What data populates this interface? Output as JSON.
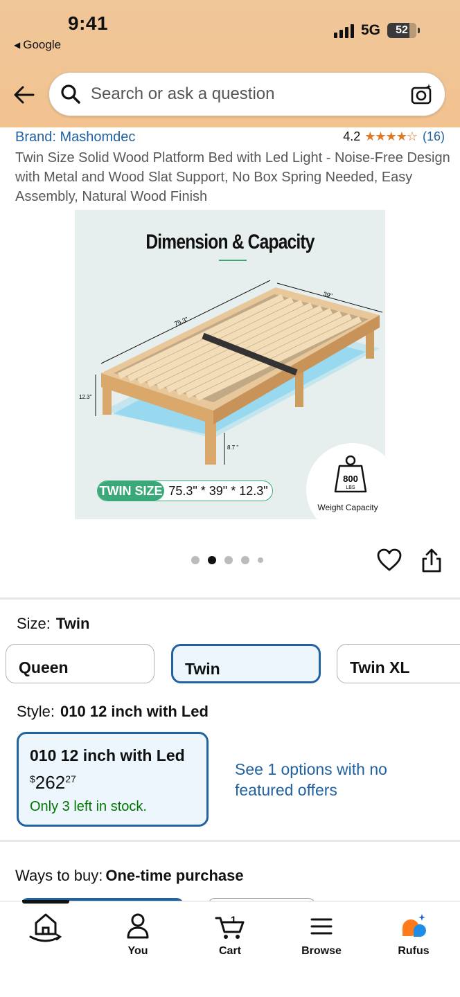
{
  "status": {
    "time": "9:41",
    "back_app": "Google",
    "network": "5G",
    "battery": "52"
  },
  "search": {
    "placeholder": "Search or ask a question"
  },
  "product": {
    "brand": "Brand: Mashomdec",
    "rating": "4.2",
    "stars": "★★★★☆",
    "review_count": "(16)",
    "title": "Twin Size Solid Wood Platform Bed with Led Light - Noise-Free Design with Metal and Wood Slat Support, No Box Spring Needed, Easy Assembly, Natural Wood Finish"
  },
  "image": {
    "heading": "Dimension & Capacity",
    "len": "75.3\"",
    "wid": "39\"",
    "height": "12.3\"",
    "leg": "8.7 \"",
    "badge_label": "TWIN SIZE",
    "badge_dims": "75.3\" * 39\" * 12.3\"",
    "weight": "800",
    "weight_unit": "LBS",
    "weight_caption": "Weight Capacity"
  },
  "carousel": {
    "image_count": 5,
    "active_index": 1
  },
  "size": {
    "label": "Size:",
    "selected": "Twin",
    "options": [
      "Queen",
      "Twin",
      "Twin XL"
    ]
  },
  "style": {
    "label": "Style:",
    "selected": "010 12 inch with Led",
    "card_name": "010 12 inch with Led",
    "price_symbol": "$",
    "price_whole": "262",
    "price_cents": "27",
    "stock": "Only 3 left in stock.",
    "see_options": "See 1 options with no featured offers"
  },
  "ways_to_buy": {
    "label": "Ways to buy:",
    "value": "One-time purchase"
  },
  "nav": {
    "you": "You",
    "cart": "Cart",
    "cart_count": "1",
    "browse": "Browse",
    "rufus": "Rufus"
  },
  "colors": {
    "link": "#2162a1",
    "stock": "#007600",
    "star": "#de7921",
    "accent": "#3aa878"
  }
}
